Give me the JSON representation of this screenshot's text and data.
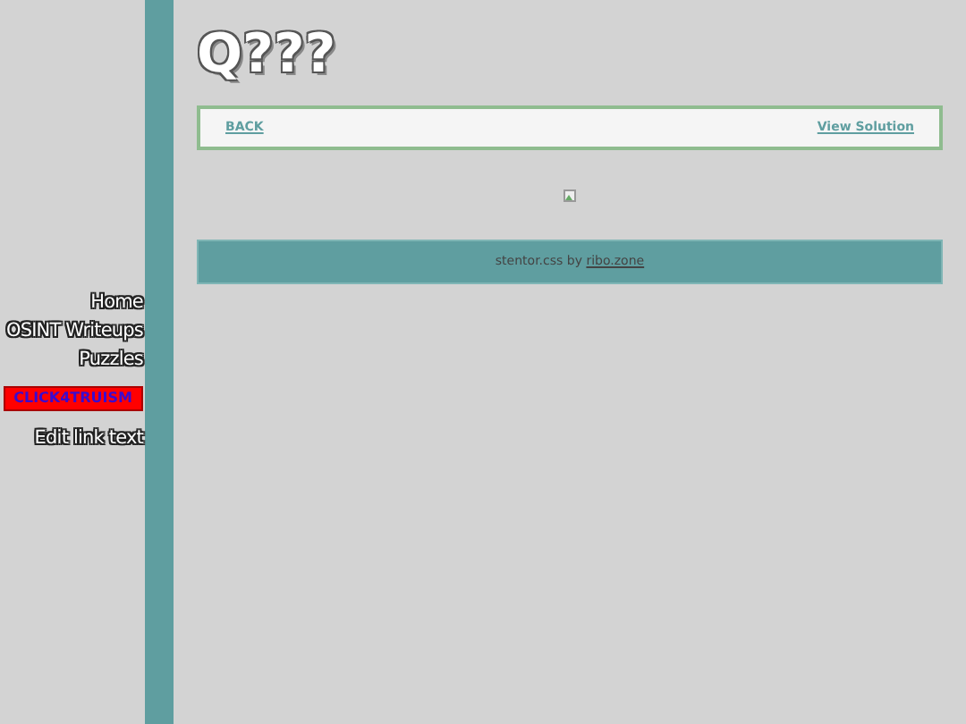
{
  "sidebar": {
    "items": [
      {
        "label": "Home",
        "kind": "link"
      },
      {
        "label": "OSINT Writeups",
        "kind": "link"
      },
      {
        "label": "Puzzles",
        "kind": "link"
      },
      {
        "label": "CLICK4TRUISM",
        "kind": "banner"
      },
      {
        "label": "Edit link text",
        "kind": "link"
      }
    ]
  },
  "title": "Q???",
  "nav": {
    "back": "BACK",
    "solution": "View Solution"
  },
  "image": {
    "kind": "broken"
  },
  "footer": {
    "text": "stentor.css by",
    "link": "ribo.zone"
  }
}
